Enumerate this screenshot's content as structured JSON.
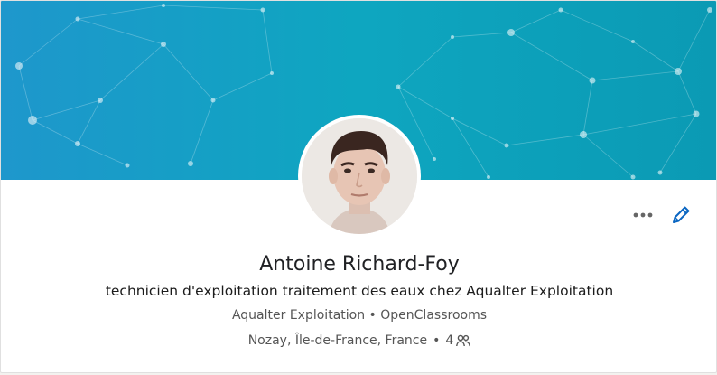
{
  "profile": {
    "name": "Antoine Richard-Foy",
    "headline": "technicien d'exploitation traitement des eaux chez Aqualter Exploitation",
    "company": "Aqualter Exploitation",
    "school": "OpenClassrooms",
    "separator": "•",
    "location": "Nozay, Île-de-France, France",
    "connections": "4"
  },
  "icons": {
    "more": "more-options-icon",
    "edit": "pencil-edit-icon",
    "connections": "people-icon"
  },
  "colors": {
    "banner_start": "#1e97cc",
    "banner_end": "#0b9ab4",
    "accent": "#0a66c2"
  }
}
